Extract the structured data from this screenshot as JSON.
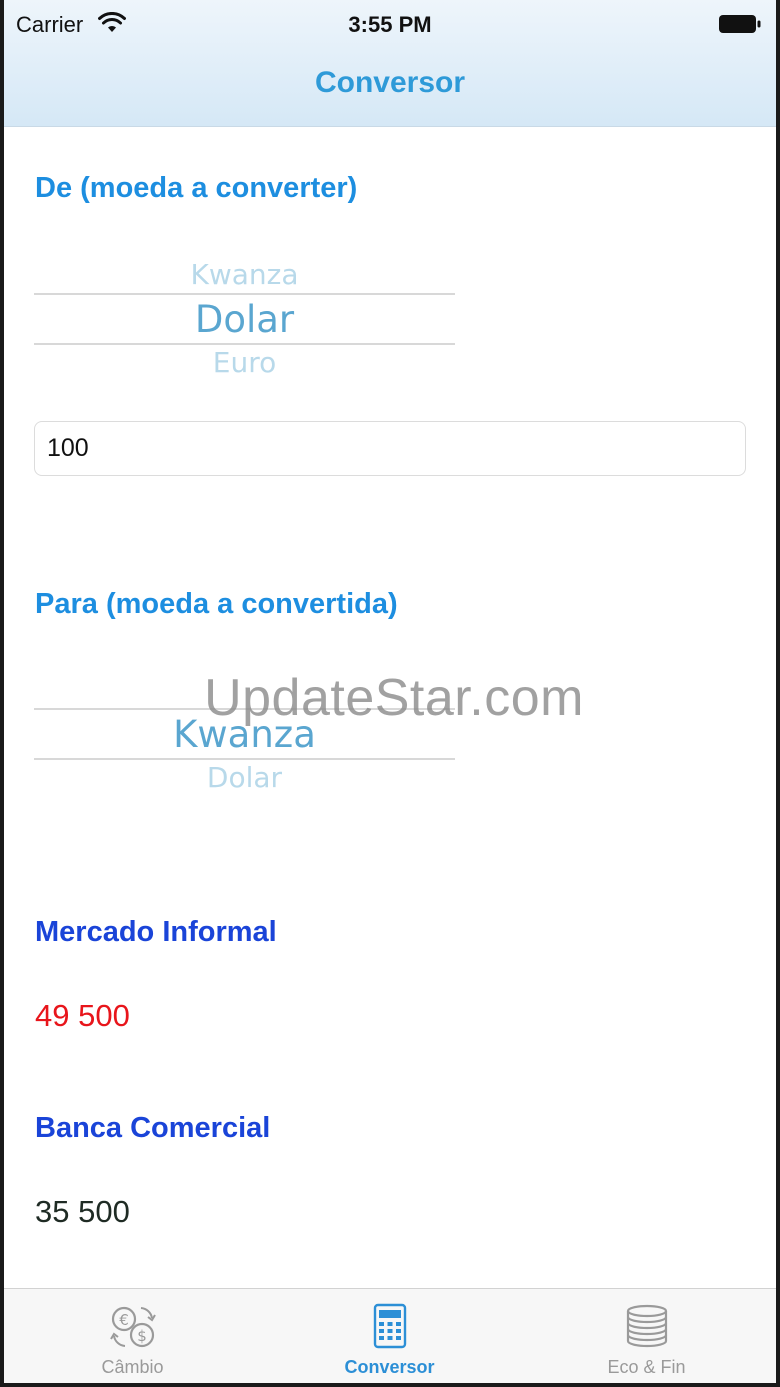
{
  "status": {
    "carrier": "Carrier",
    "time": "3:55 PM"
  },
  "nav": {
    "title": "Conversor"
  },
  "from": {
    "title": "De (moeda a converter)",
    "picker": {
      "above": "Kwanza",
      "selected": "Dolar",
      "below": "Euro"
    },
    "amount": "100"
  },
  "to": {
    "title": "Para (moeda a convertida)",
    "picker": {
      "selected": "Kwanza",
      "below": "Dolar"
    }
  },
  "watermark": "UpdateStar.com",
  "results": {
    "informal": {
      "label": "Mercado Informal",
      "value": "49 500",
      "color": "#e8151b"
    },
    "banca": {
      "label": "Banca Comercial",
      "value": "35 500",
      "color": "#1f2b24"
    }
  },
  "tabs": [
    {
      "label": "Câmbio",
      "icon": "currency-exchange-icon",
      "active": false
    },
    {
      "label": "Conversor",
      "icon": "calculator-icon",
      "active": true
    },
    {
      "label": "Eco & Fin",
      "icon": "coins-stack-icon",
      "active": false
    }
  ],
  "colors": {
    "accent": "#2c8fd6",
    "section": "#1d8ee0",
    "result_title": "#1a44d8"
  }
}
